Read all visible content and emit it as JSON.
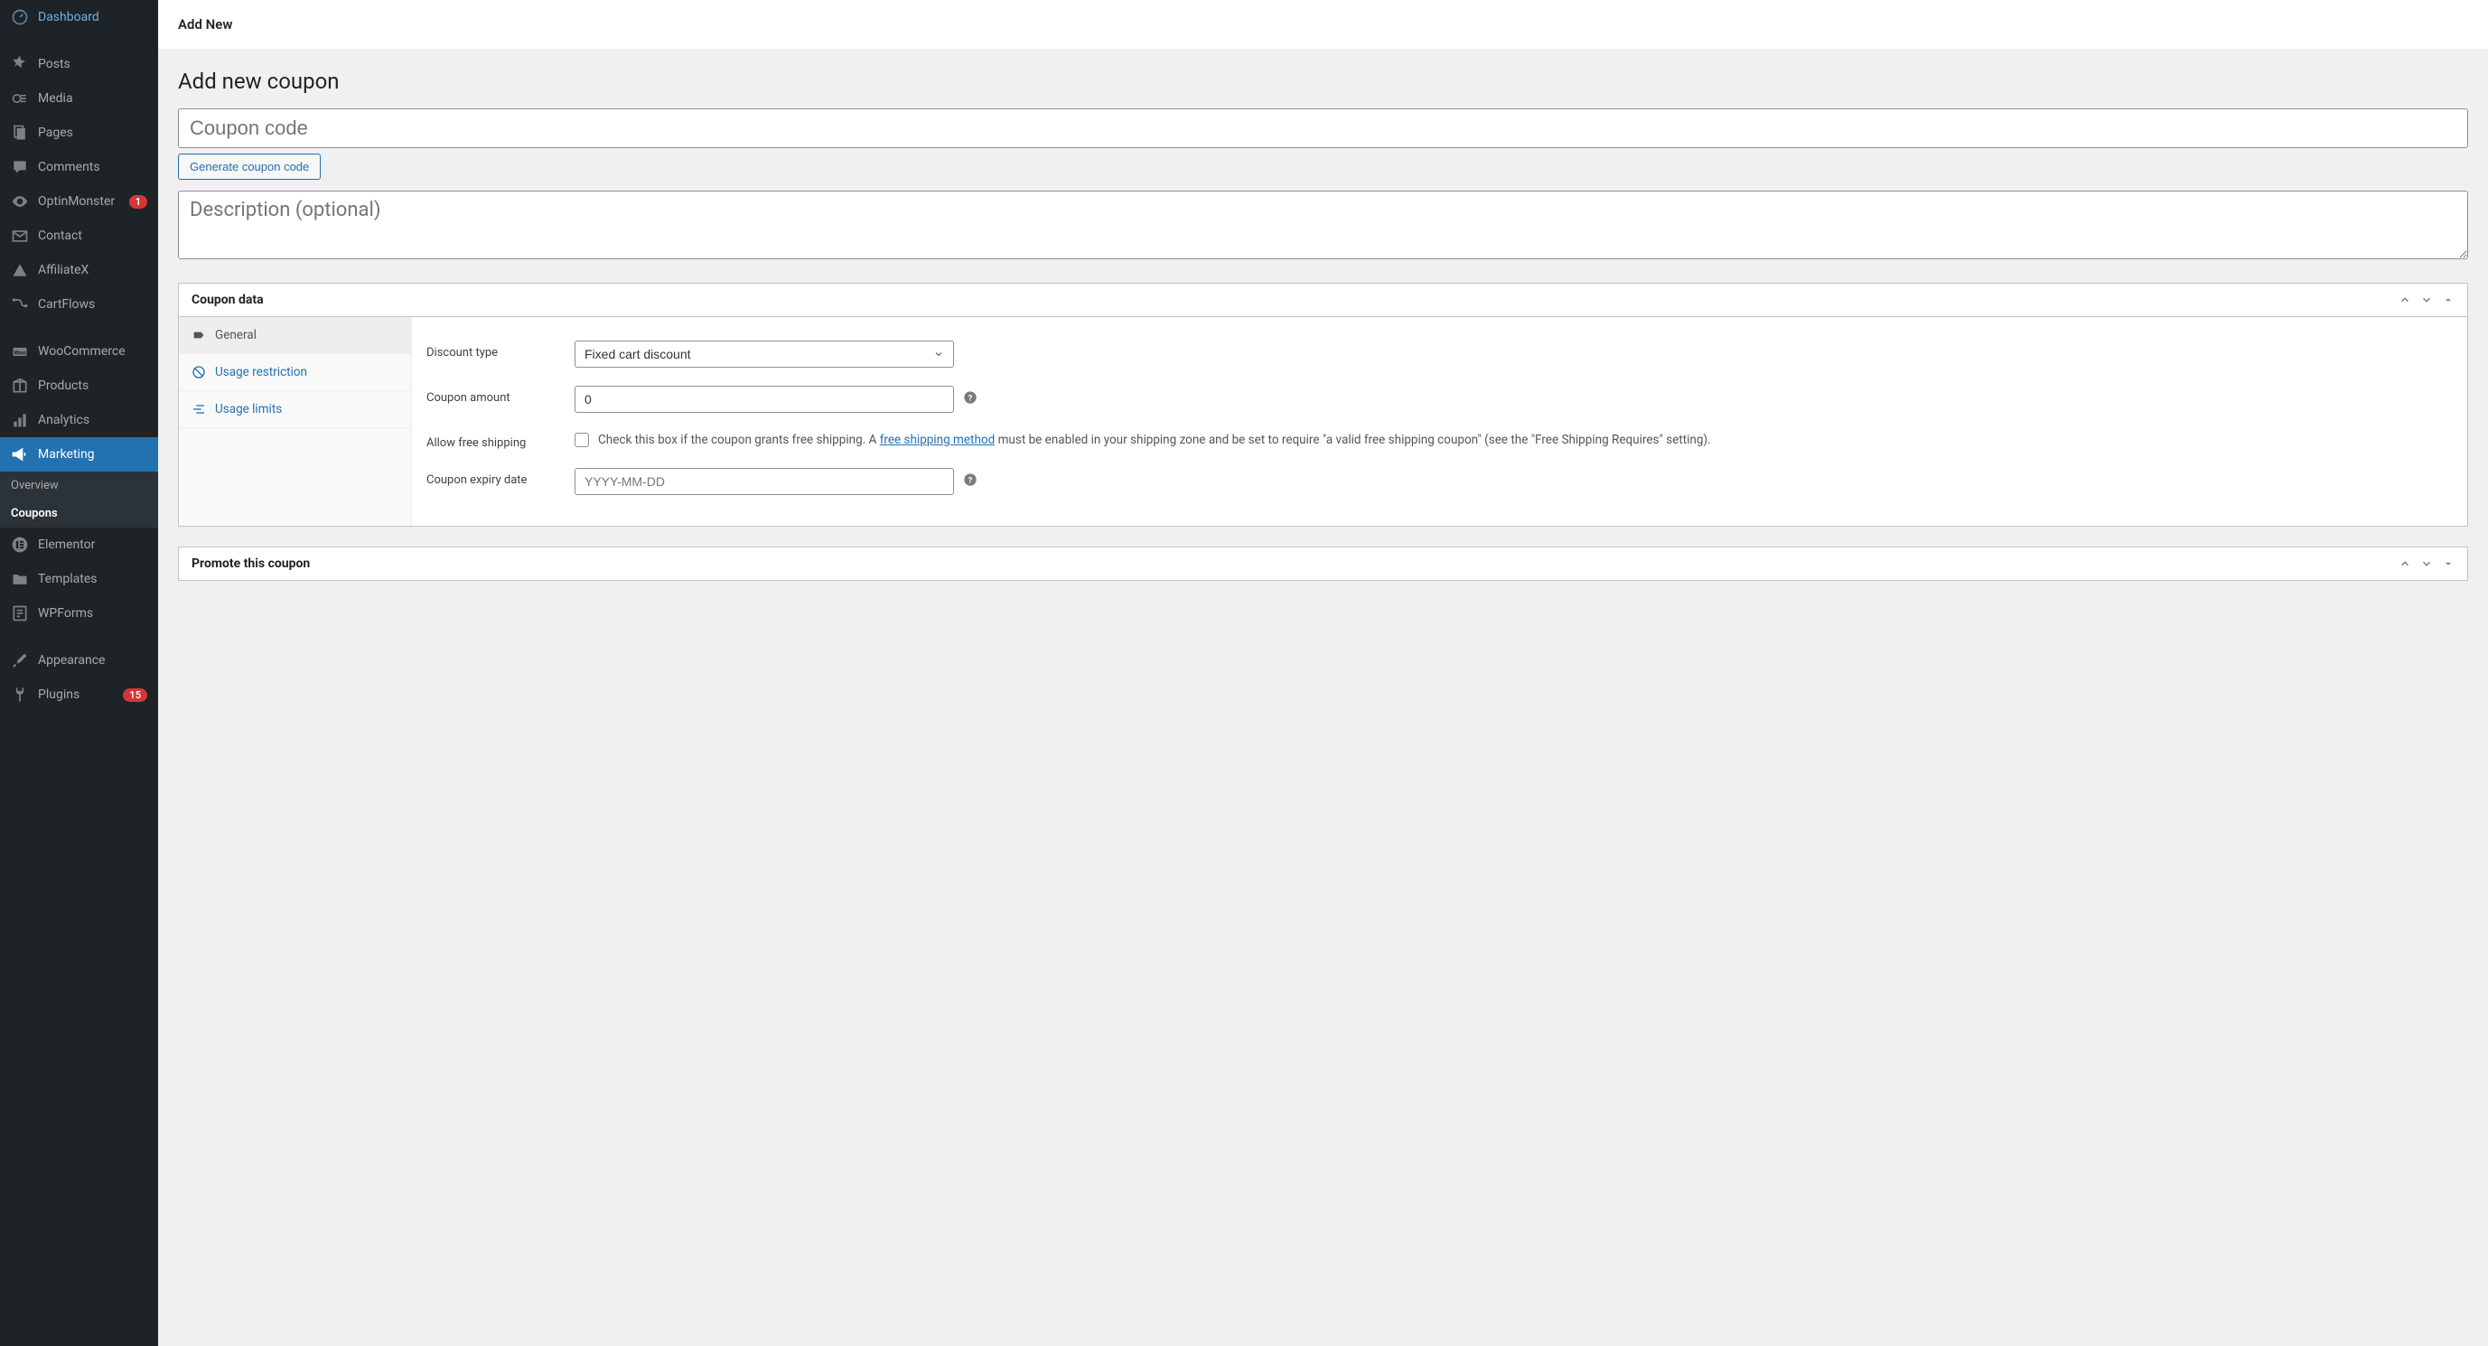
{
  "topbar": {
    "title": "Add New"
  },
  "sidebar": {
    "items": [
      {
        "id": "dashboard",
        "label": "Dashboard",
        "icon": "dashboard"
      },
      {
        "id": "posts",
        "label": "Posts",
        "icon": "pin"
      },
      {
        "id": "media",
        "label": "Media",
        "icon": "media"
      },
      {
        "id": "pages",
        "label": "Pages",
        "icon": "pages"
      },
      {
        "id": "comments",
        "label": "Comments",
        "icon": "comment"
      },
      {
        "id": "optinmonster",
        "label": "OptinMonster",
        "icon": "eye",
        "badge": "1"
      },
      {
        "id": "contact",
        "label": "Contact",
        "icon": "mail"
      },
      {
        "id": "affiliatex",
        "label": "AffiliateX",
        "icon": "triangle"
      },
      {
        "id": "cartflows",
        "label": "CartFlows",
        "icon": "flow"
      },
      {
        "id": "woocommerce",
        "label": "WooCommerce",
        "icon": "woo"
      },
      {
        "id": "products",
        "label": "Products",
        "icon": "box"
      },
      {
        "id": "analytics",
        "label": "Analytics",
        "icon": "chart"
      },
      {
        "id": "marketing",
        "label": "Marketing",
        "icon": "megaphone",
        "active": true
      },
      {
        "id": "elementor",
        "label": "Elementor",
        "icon": "elementor"
      },
      {
        "id": "templates",
        "label": "Templates",
        "icon": "folder"
      },
      {
        "id": "wpforms",
        "label": "WPForms",
        "icon": "form"
      },
      {
        "id": "appearance",
        "label": "Appearance",
        "icon": "brush"
      },
      {
        "id": "plugins",
        "label": "Plugins",
        "icon": "plug",
        "badge": "15"
      }
    ],
    "sub": [
      {
        "label": "Overview"
      },
      {
        "label": "Coupons",
        "active": true
      }
    ]
  },
  "page": {
    "title": "Add new coupon",
    "coupon_placeholder": "Coupon code",
    "generate_label": "Generate coupon code",
    "desc_placeholder": "Description (optional)"
  },
  "coupon_panel": {
    "title": "Coupon data",
    "tabs": {
      "general": "General",
      "usage_restriction": "Usage restriction",
      "usage_limits": "Usage limits"
    },
    "fields": {
      "discount_type": {
        "label": "Discount type",
        "value": "Fixed cart discount"
      },
      "coupon_amount": {
        "label": "Coupon amount",
        "value": "0"
      },
      "free_shipping": {
        "label": "Allow free shipping",
        "text1": "Check this box if the coupon grants free shipping. A ",
        "link": "free shipping method",
        "text2": " must be enabled in your shipping zone and be set to require \"a valid free shipping coupon\" (see the \"Free Shipping Requires\" setting)."
      },
      "expiry": {
        "label": "Coupon expiry date",
        "placeholder": "YYYY-MM-DD"
      }
    }
  },
  "promote_panel": {
    "title": "Promote this coupon"
  }
}
